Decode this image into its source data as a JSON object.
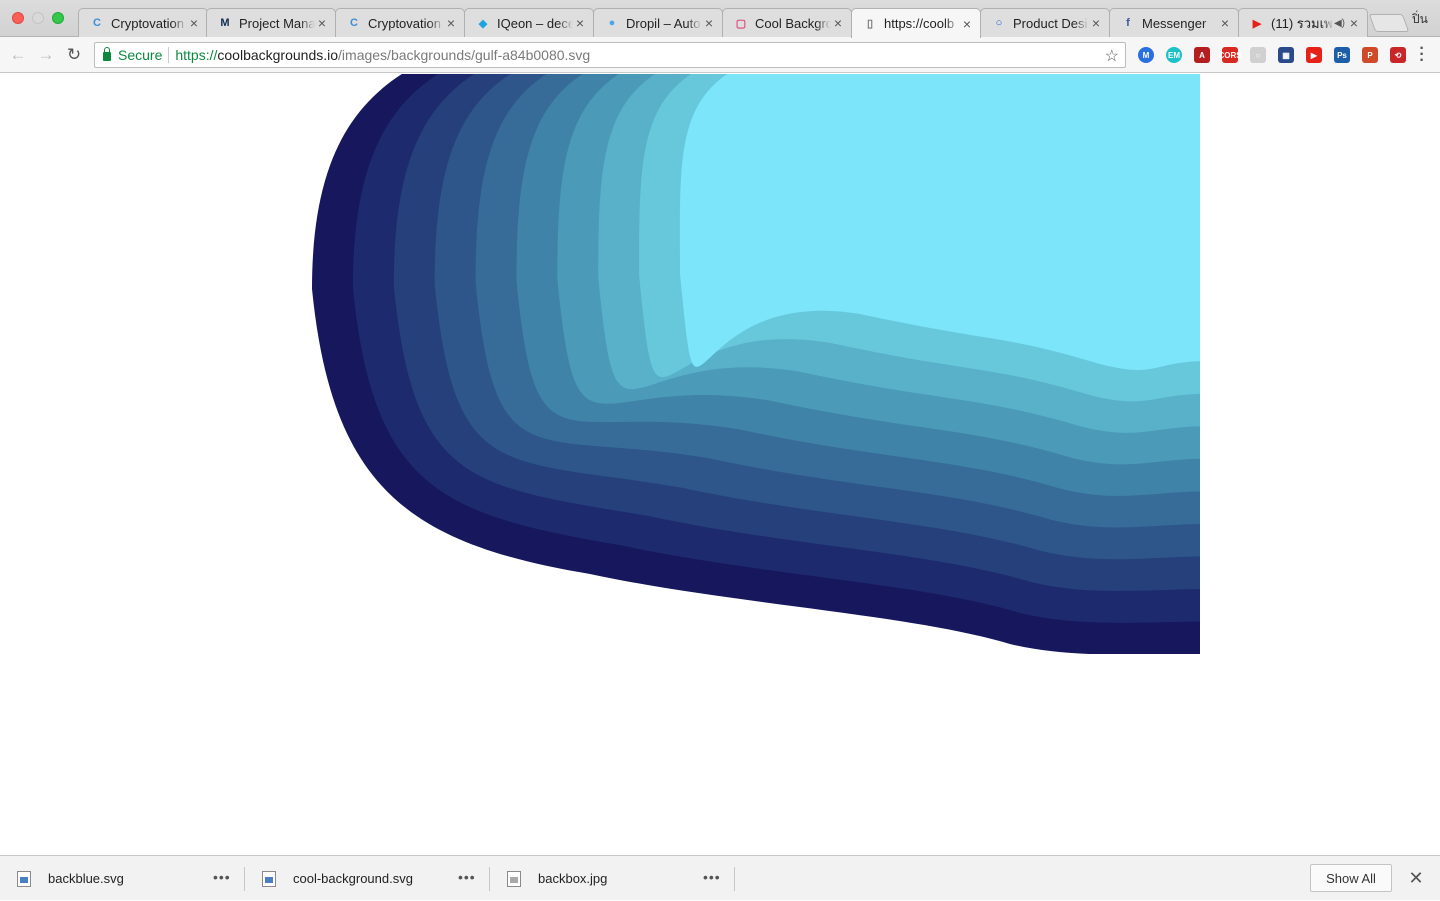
{
  "tabs": [
    {
      "title": "Cryptovation",
      "favicon": "cryptovation-icon",
      "color": "#3d8fd6",
      "glyph": "C"
    },
    {
      "title": "Project Mana",
      "favicon": "project-management-icon",
      "color": "#0d2d4f",
      "glyph": "M"
    },
    {
      "title": "Cryptovation",
      "favicon": "cryptovation-icon",
      "color": "#3d8fd6",
      "glyph": "C"
    },
    {
      "title": "IQeon – dece",
      "favicon": "iqeon-cube-icon",
      "color": "#1fa3e0",
      "glyph": "◆"
    },
    {
      "title": "Dropil – Auto",
      "favicon": "dropil-drop-icon",
      "color": "#4aa6e8",
      "glyph": "●"
    },
    {
      "title": "Cool Backgro",
      "favicon": "cool-backgrounds-icon",
      "color": "#e0467a",
      "glyph": "▢"
    },
    {
      "title": "https://coolb",
      "favicon": "blank-page-icon",
      "color": "#777777",
      "glyph": "▯",
      "active": true
    },
    {
      "title": "Product Desi",
      "favicon": "product-design-icon",
      "color": "#1e5ed8",
      "glyph": "○"
    },
    {
      "title": "Messenger",
      "favicon": "facebook-icon",
      "color": "#3b5998",
      "glyph": "f"
    },
    {
      "title": "(11) รวมเพล",
      "favicon": "youtube-icon",
      "color": "#e62117",
      "glyph": "▶",
      "muted": true
    }
  ],
  "profile_label": "ปิ่น",
  "toolbar": {
    "secure_label": "Secure",
    "url_scheme": "https://",
    "url_host": "coolbackgrounds.io",
    "url_path": "/images/backgrounds/gulf-a84b0080.svg"
  },
  "extensions": [
    {
      "name": "momentum-extension-icon",
      "color": "#2a6fe0",
      "glyph": "M"
    },
    {
      "name": "em-extension-icon",
      "color": "#1cc1c9",
      "glyph": "EM"
    },
    {
      "name": "acrobat-extension-icon",
      "color": "#b41e1e",
      "glyph": "A"
    },
    {
      "name": "cors-extension-icon",
      "color": "#d9281f",
      "glyph": "CORS"
    },
    {
      "name": "circle-extension-icon",
      "color": "#d0d0d0",
      "glyph": "○"
    },
    {
      "name": "clapper-extension-icon",
      "color": "#2b4a8a",
      "glyph": "▦"
    },
    {
      "name": "youtube-extension-icon",
      "color": "#e62117",
      "glyph": "▶"
    },
    {
      "name": "photoshop-extension-icon",
      "color": "#1c5fa8",
      "glyph": "Ps"
    },
    {
      "name": "p-extension-icon",
      "color": "#d04a2a",
      "glyph": "P"
    },
    {
      "name": "repeat-extension-icon",
      "color": "#c9262a",
      "glyph": "⟲"
    }
  ],
  "downloads": [
    {
      "filename": "backblue.svg",
      "type": "svg"
    },
    {
      "filename": "cool-background.svg",
      "type": "svg"
    },
    {
      "filename": "backbox.jpg",
      "type": "jpg"
    }
  ],
  "shelf": {
    "show_all_label": "Show All",
    "close_glyph": "✕"
  },
  "background_colors": [
    "#17175e",
    "#1e2a6e",
    "#26407c",
    "#2e568a",
    "#376c98",
    "#4083a8",
    "#4b9ab8",
    "#58b1c9",
    "#68c8db",
    "#7ce5fa"
  ]
}
